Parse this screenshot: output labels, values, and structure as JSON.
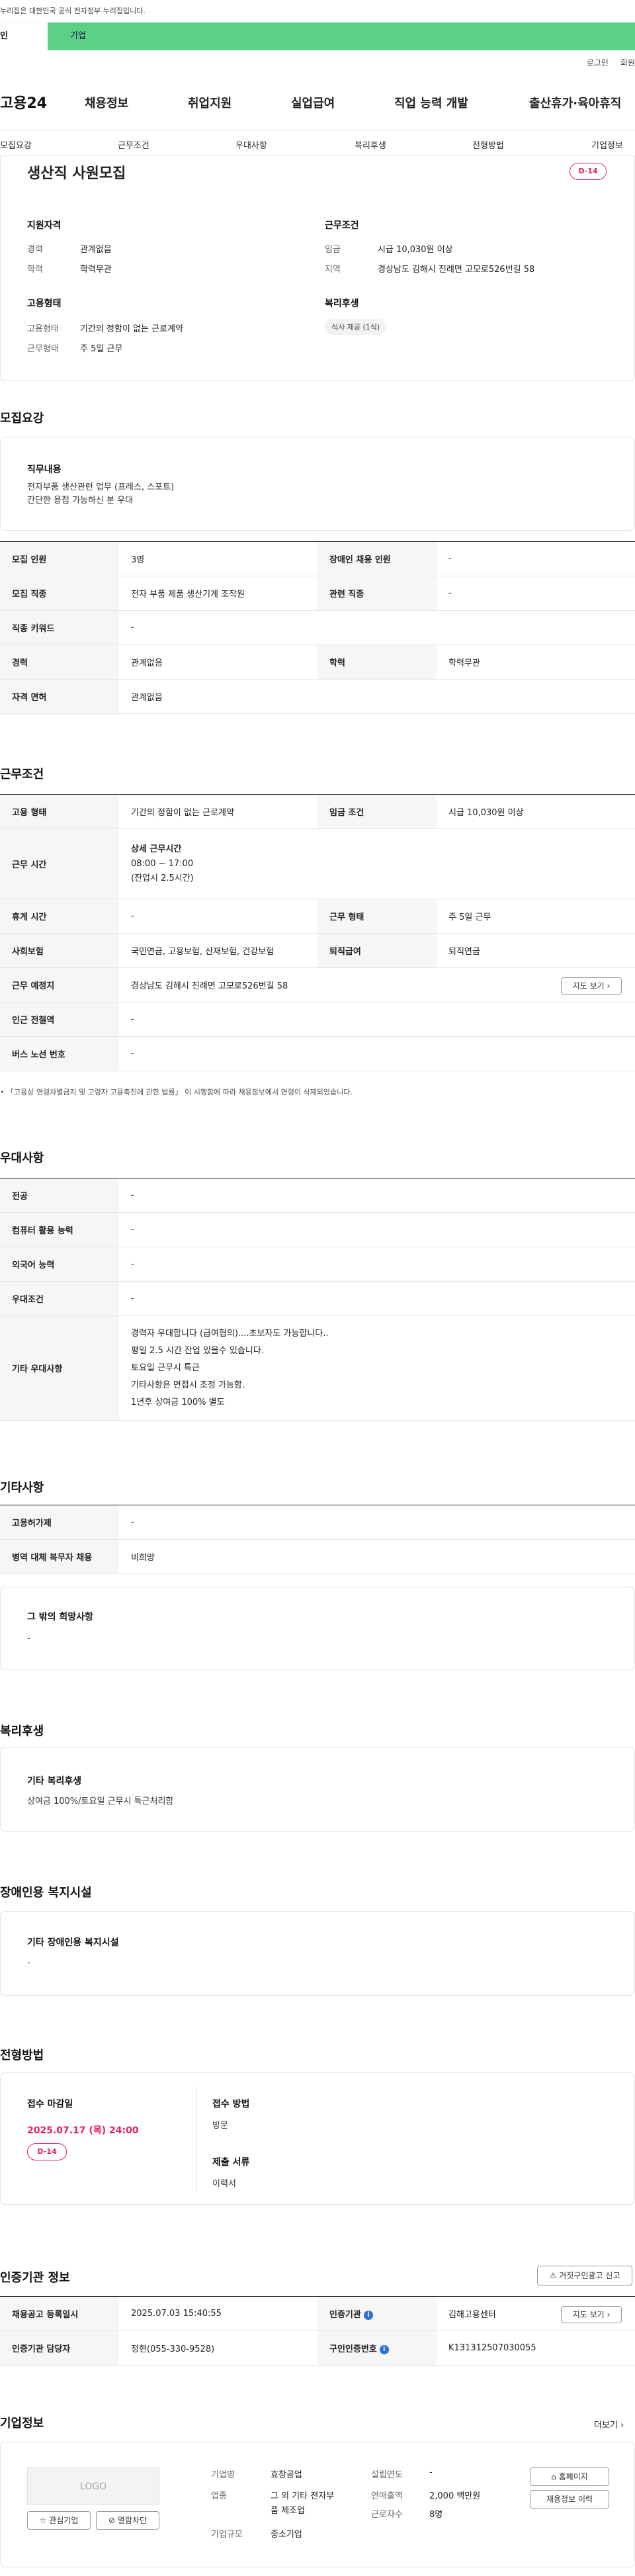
{
  "topbar": {
    "notice": "누리집은 대한민국 공식 전자정부 누리집입니다."
  },
  "tabs": {
    "person": "인",
    "company": "기업"
  },
  "util": {
    "login": "로그인",
    "join": "회원"
  },
  "gnb": {
    "logo": "고용24",
    "menus": [
      "채용정보",
      "취업지원",
      "실업급여",
      "직업 능력 개발",
      "출산휴가·육아휴직"
    ]
  },
  "lnb": [
    "모집요강",
    "근무조건",
    "우대사항",
    "복리후생",
    "전형방법",
    "기업정보"
  ],
  "summary": {
    "title": "생산직 사원모집",
    "dday": "D-14",
    "qual_h": "지원자격",
    "exp_lbl": "경력",
    "exp_val": "관계없음",
    "edu_lbl": "학력",
    "edu_val": "학력무관",
    "cond_h": "근무조건",
    "wage_lbl": "임금",
    "wage_val": "시급 10,030원 이상",
    "area_lbl": "지역",
    "area_val": "경상남도 김해시 진례면 고모로526번길 58",
    "emp_h": "고용형태",
    "emp_lbl": "고용형태",
    "emp_val": "기간의 정함이 없는 근로계약",
    "work_lbl": "근무형태",
    "work_val": "주 5일 근무",
    "welfare_h": "복리후생",
    "welfare_tag": "식사 제공 (1식)"
  },
  "recruit": {
    "heading": "모집요강",
    "duty_h": "직무내용",
    "duty_lines": [
      "전자부품 생산관련 업무 (프레스, 스포트)",
      "간단한 용접 가능하신 분 우대"
    ],
    "rows": {
      "r1a": "모집 인원",
      "r1av": "3명",
      "r1b": "장애인 채용 인원",
      "r1bv": "-",
      "r2a": "모집 직종",
      "r2av": "전자 부품 제품 생산기계 조작원",
      "r2b": "관련 직종",
      "r2bv": "-",
      "r3a": "직종 키워드",
      "r3av": "-",
      "r4a": "경력",
      "r4av": "관계없음",
      "r4b": "학력",
      "r4bv": "학력무관",
      "r5a": "자격 면허",
      "r5av": "관계없음"
    }
  },
  "cond": {
    "heading": "근무조건",
    "r1a": "고용 형태",
    "r1av": "기간의 정함이 없는 근로계약",
    "r1b": "임금 조건",
    "r1bv": "시급 10,030원 이상",
    "r2a": "근무 시간",
    "r2h": "상세 근무시간",
    "r2l1": "08:00 ~ 17:00",
    "r2l2": "(잔업시 2.5시간)",
    "r3a": "휴게 시간",
    "r3av": "-",
    "r3b": "근무 형태",
    "r3bv": "주 5일 근무",
    "r4a": "사회보험",
    "r4av": "국민연금, 고용보험, 산재보험, 건강보험",
    "r4b": "퇴직급여",
    "r4bv": "퇴직연금",
    "r5a": "근무 예정지",
    "r5av": "경상남도 김해시 진례면 고모로526번길 58",
    "map_btn": "지도 보기",
    "r6a": "인근 전철역",
    "r6av": "-",
    "r7a": "버스 노선 번호",
    "r7av": "-",
    "note": "「고용상 연령차별금지 및 고령자 고용촉진에 관한 법률」 이 시행함에 따라 채용정보에서 연령이 삭제되었습니다."
  },
  "pref": {
    "heading": "우대사항",
    "r1a": "전공",
    "r1av": "-",
    "r2a": "컴퓨터 활용 능력",
    "r2av": "-",
    "r3a": "외국어 능력",
    "r3av": "-",
    "r4a": "우대조건",
    "r4av": "-",
    "r5a": "기타 우대사항",
    "r5lines": [
      "경력자 우대합니다 (급여협의)....초보자도 가능합니다..",
      "평일 2.5 시간 잔업 있을수 있습니다.",
      "토요일 근무시 특근",
      "기타사항은 면접시 조정 가능함.",
      "1년후 상여금 100% 별도"
    ]
  },
  "etc": {
    "heading": "기타사항",
    "r1a": "고용허가제",
    "r1av": "-",
    "r2a": "병역 대체 복무자 채용",
    "r2av": "비희망",
    "wish_h": "그 밖의 희망사항",
    "wish_v": "-"
  },
  "welfare": {
    "heading": "복리후생",
    "sub_h": "기타 복리후생",
    "sub_v": "상여금 100%/토요일 근무시 특근처리함"
  },
  "disabled": {
    "heading": "장애인용 복지시설",
    "sub_h": "기타 장애인용 복지시설",
    "sub_v": "-"
  },
  "process": {
    "heading": "전형방법",
    "deadline_h": "접수 마감일",
    "deadline_v": "2025.07.17 (목) 24:00",
    "dday": "D-14",
    "method_h": "접수 방법",
    "method_v": "방문",
    "docs_h": "제출 서류",
    "docs_v": "이력서"
  },
  "cert": {
    "heading": "인증기관 정보",
    "report_btn": "거짓구인광고 신고",
    "r1a": "채용공고 등록일시",
    "r1av": "2025.07.03 15:40:55",
    "r1b": "인증기관",
    "r1bv": "김해고용센터",
    "map_btn": "지도 보기",
    "r2a": "인증기관 담당자",
    "r2av": "정현(055-330-9528)",
    "r2b": "구인인증번호",
    "r2bv": "K131312507030055"
  },
  "company": {
    "heading": "기업정보",
    "more": "더보기",
    "logo": "LOGO",
    "fav_btn": "관심기업",
    "block_btn": "열람차단",
    "name_lbl": "기업명",
    "name_val": "효창공업",
    "biz_lbl": "업종",
    "biz_val1": "그 외 기타 전자부",
    "biz_val2": "품 제조업",
    "size_lbl": "기업규모",
    "size_val": "중소기업",
    "est_lbl": "설립연도",
    "est_val": "-",
    "sales_lbl": "연매출액",
    "sales_val": "2,000 백만원",
    "staff_lbl": "근로자수",
    "staff_val": "8명",
    "home_btn": "홈페이지",
    "hist_btn": "채용정보 이력"
  }
}
